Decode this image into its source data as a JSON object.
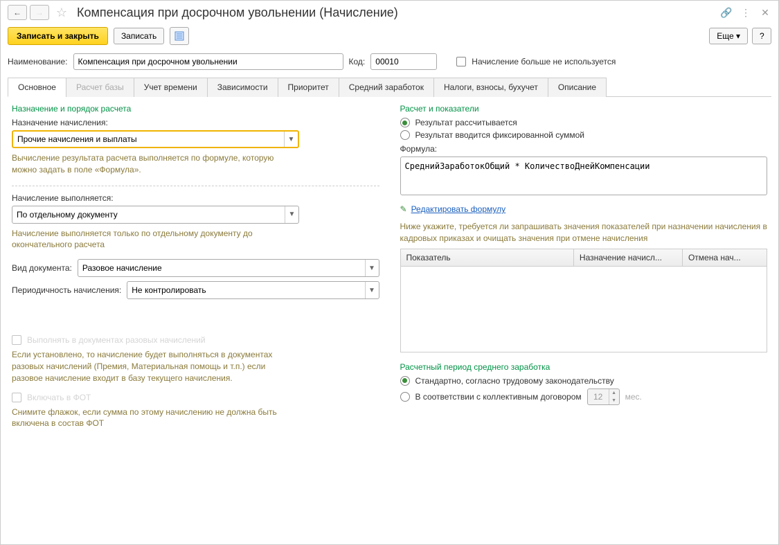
{
  "title": "Компенсация при досрочном увольнении (Начисление)",
  "toolbar": {
    "save_close": "Записать и закрыть",
    "save": "Записать",
    "more": "Еще",
    "help": "?"
  },
  "header": {
    "name_label": "Наименование:",
    "name_value": "Компенсация при досрочном увольнении",
    "code_label": "Код:",
    "code_value": "00010",
    "not_used_label": "Начисление больше не используется"
  },
  "tabs": [
    "Основное",
    "Расчет базы",
    "Учет времени",
    "Зависимости",
    "Приоритет",
    "Средний заработок",
    "Налоги, взносы, бухучет",
    "Описание"
  ],
  "active_tab": 0,
  "disabled_tab": 1,
  "left": {
    "section1_title": "Назначение и порядок расчета",
    "purpose_label": "Назначение начисления:",
    "purpose_value": "Прочие начисления и выплаты",
    "purpose_hint": "Вычисление результата расчета выполняется по формуле, которую можно задать в поле «Формула».",
    "performed_label": "Начисление выполняется:",
    "performed_value": "По отдельному документу",
    "performed_hint": "Начисление выполняется только по отдельному документу до окончательного расчета",
    "doc_type_label": "Вид документа:",
    "doc_type_value": "Разовое начисление",
    "periodicity_label": "Периодичность начисления:",
    "periodicity_value": "Не контролировать",
    "cb1_label": "Выполнять в документах разовых начислений",
    "cb1_hint": "Если установлено, то начисление будет выполняться в документах разовых начислений (Премия, Материальная помощь и т.п.) если разовое начисление входит в базу текущего начисления.",
    "cb2_label": "Включать в ФОТ",
    "cb2_hint": "Снимите флажок, если сумма по этому начислению не должна быть включена в состав ФОТ"
  },
  "right": {
    "section2_title": "Расчет и показатели",
    "r1": "Результат рассчитывается",
    "r2": "Результат вводится фиксированной суммой",
    "formula_label": "Формула:",
    "formula_value": "СреднийЗаработокОбщий * КоличествоДнейКомпенсации",
    "edit_formula": "Редактировать формулу",
    "table_hint": "Ниже укажите, требуется ли запрашивать значения показателей при назначении начисления в кадровых приказах и очищать значения при отмене начисления",
    "th1": "Показатель",
    "th2": "Назначение начисл...",
    "th3": "Отмена нач...",
    "section3_title": "Расчетный период среднего заработка",
    "p1": "Стандартно, согласно трудовому законодательству",
    "p2": "В соответствии с коллективным договором",
    "months_value": "12",
    "months_suffix": "мес."
  }
}
